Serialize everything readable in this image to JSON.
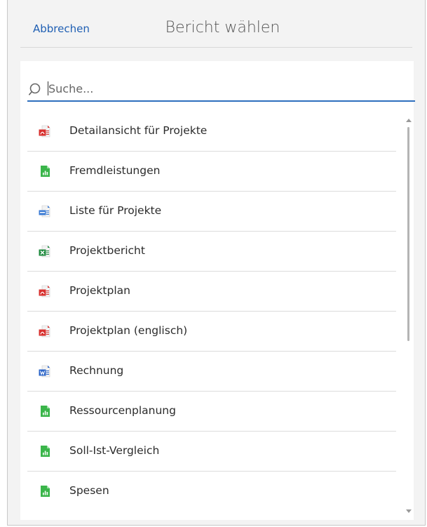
{
  "header": {
    "cancel_label": "Abbrechen",
    "title": "Bericht wählen"
  },
  "search": {
    "placeholder": "Suche...",
    "value": ""
  },
  "reports": [
    {
      "label": "Detailansicht für Projekte",
      "icon": "pdf-file-icon",
      "color": "#d8312f"
    },
    {
      "label": "Fremdleistungen",
      "icon": "chart-file-icon",
      "color": "#3ab54a"
    },
    {
      "label": "Liste für Projekte",
      "icon": "csv-file-icon",
      "color": "#3b7bd4"
    },
    {
      "label": "Projektbericht",
      "icon": "excel-file-icon",
      "color": "#1e8a3e"
    },
    {
      "label": "Projektplan",
      "icon": "pdf-file-icon",
      "color": "#d8312f"
    },
    {
      "label": "Projektplan (englisch)",
      "icon": "pdf-file-icon",
      "color": "#d8312f"
    },
    {
      "label": "Rechnung",
      "icon": "word-file-icon",
      "color": "#2b64c8"
    },
    {
      "label": "Ressourcenplanung",
      "icon": "chart-file-icon",
      "color": "#3ab54a"
    },
    {
      "label": "Soll-Ist-Vergleich",
      "icon": "chart-file-icon",
      "color": "#3ab54a"
    },
    {
      "label": "Spesen",
      "icon": "chart-file-icon",
      "color": "#3ab54a"
    }
  ],
  "colors": {
    "accent": "#2e6fbe",
    "link": "#1f5fb3"
  }
}
